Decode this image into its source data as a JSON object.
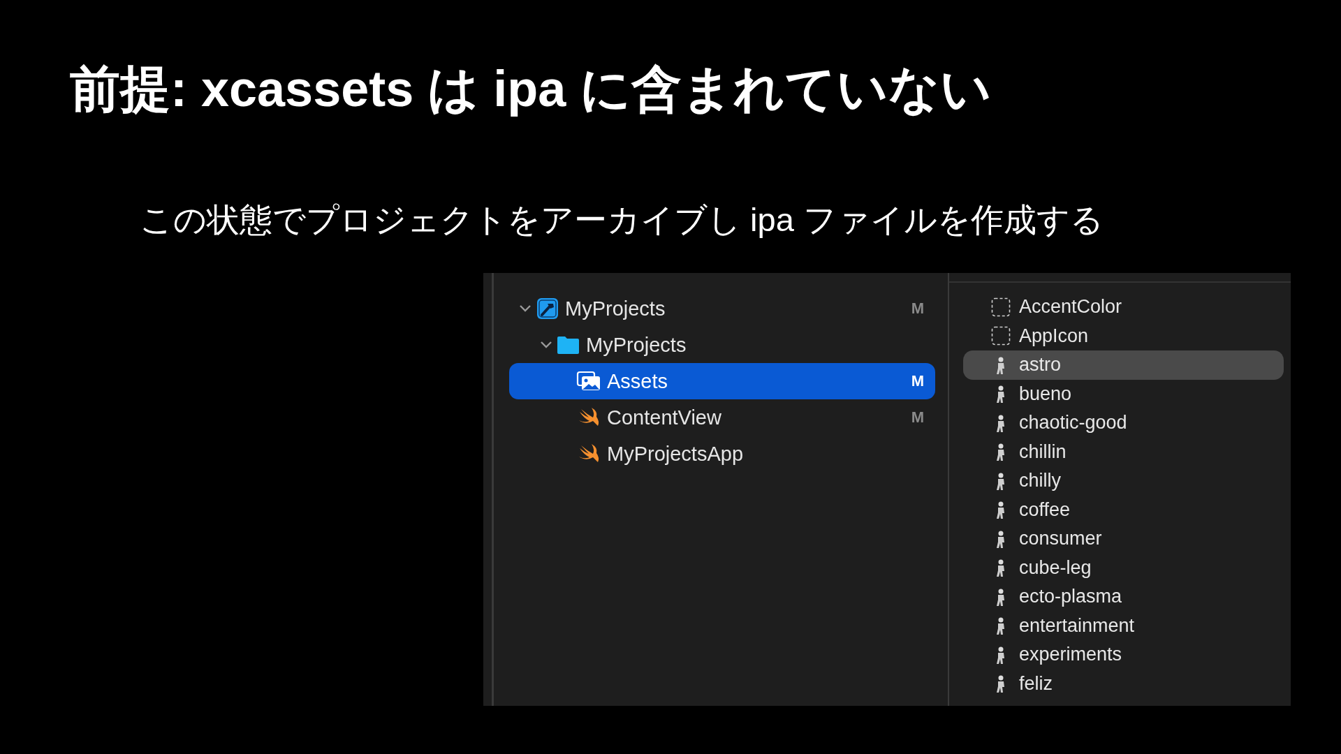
{
  "title": "前提: xcassets は ipa に含まれていない",
  "subtitle": "この状態でプロジェクトをアーカイブし ipa ファイルを作成する",
  "navigator": {
    "items": [
      {
        "label": "MyProjects",
        "kind": "project",
        "status": "M",
        "expanded": true,
        "selected": false,
        "children": [
          {
            "label": "MyProjects",
            "kind": "folder",
            "expanded": true,
            "selected": false,
            "children": [
              {
                "label": "Assets",
                "kind": "asset-catalog",
                "status": "M",
                "selected": true
              },
              {
                "label": "ContentView",
                "kind": "swift",
                "status": "M",
                "selected": false
              },
              {
                "label": "MyProjectsApp",
                "kind": "swift",
                "selected": false
              }
            ]
          }
        ]
      }
    ]
  },
  "assets": {
    "items": [
      {
        "label": "AccentColor",
        "kind": "placeholder",
        "selected": false
      },
      {
        "label": "AppIcon",
        "kind": "placeholder",
        "selected": false
      },
      {
        "label": "astro",
        "kind": "image",
        "selected": true
      },
      {
        "label": "bueno",
        "kind": "image",
        "selected": false
      },
      {
        "label": "chaotic-good",
        "kind": "image",
        "selected": false
      },
      {
        "label": "chillin",
        "kind": "image",
        "selected": false
      },
      {
        "label": "chilly",
        "kind": "image",
        "selected": false
      },
      {
        "label": "coffee",
        "kind": "image",
        "selected": false
      },
      {
        "label": "consumer",
        "kind": "image",
        "selected": false
      },
      {
        "label": "cube-leg",
        "kind": "image",
        "selected": false
      },
      {
        "label": "ecto-plasma",
        "kind": "image",
        "selected": false
      },
      {
        "label": "entertainment",
        "kind": "image",
        "selected": false
      },
      {
        "label": "experiments",
        "kind": "image",
        "selected": false
      },
      {
        "label": "feliz",
        "kind": "image",
        "selected": false
      }
    ]
  }
}
